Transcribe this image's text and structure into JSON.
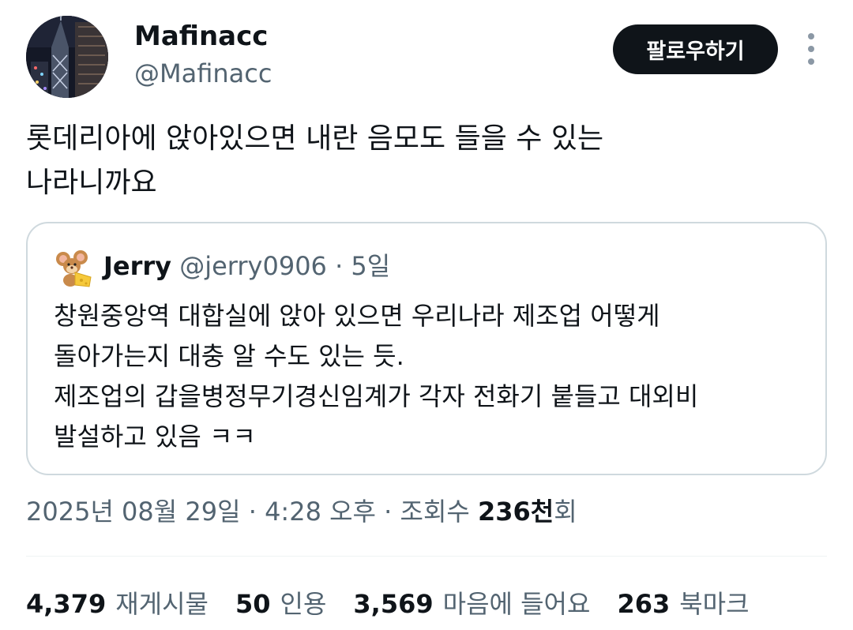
{
  "author": {
    "display_name": "Mafinacc",
    "handle": "@Mafinacc",
    "avatar_icon": "night-city-skyline-avatar"
  },
  "follow_button": {
    "label": "팔로우하기"
  },
  "more_icon": "more-vertical-icon",
  "tweet": {
    "lines": [
      "롯데리아에 앉아있으면 내란 음모도 들을 수 있는",
      "나라니까요"
    ]
  },
  "quote": {
    "display_name": "Jerry",
    "handle": "@jerry0906",
    "separator": "·",
    "time": "5일",
    "avatar_icon": "mouse-with-cheese-avatar",
    "lines": [
      "창원중앙역 대합실에 앉아 있으면 우리나라 제조업 어떻게",
      "돌아가는지 대충 알 수도 있는 듯.",
      "제조업의 갑을병정무기경신임계가 각자 전화기 붙들고 대외비",
      "발설하고 있음 ㅋㅋ"
    ]
  },
  "meta": {
    "date": "2025년 08월 29일",
    "sep1": " · ",
    "time": "4:28 오후",
    "sep2": " · ",
    "views_label": "조회수 ",
    "views_value": "236천",
    "views_suffix": "회"
  },
  "stats": [
    {
      "value": "4,379",
      "label": "재게시물"
    },
    {
      "value": "50",
      "label": "인용"
    },
    {
      "value": "3,569",
      "label": "마음에 들어요"
    },
    {
      "value": "263",
      "label": "북마크"
    }
  ],
  "colors": {
    "text_primary": "#0f1419",
    "text_secondary": "#536471",
    "border": "#cfd9de",
    "button_bg": "#0f1419",
    "button_text": "#ffffff"
  }
}
